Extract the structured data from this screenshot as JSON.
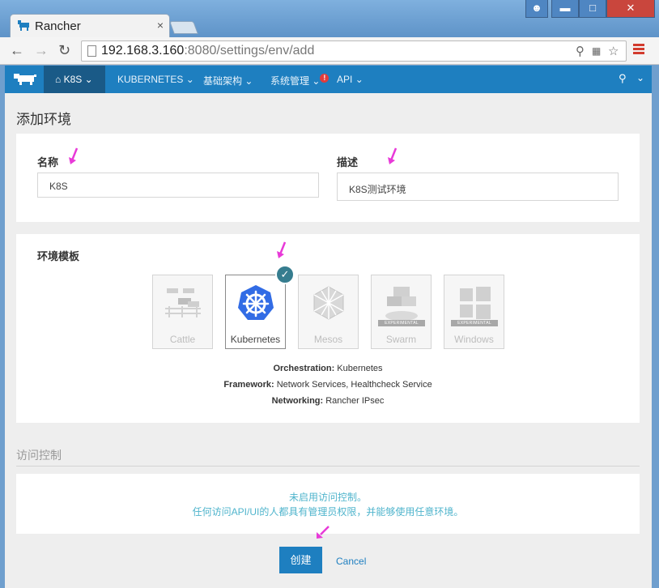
{
  "browser": {
    "tab_title": "Rancher",
    "tab_close": "×",
    "url_host": "192.168.3.160",
    "url_rest": ":8080/settings/env/add"
  },
  "nav": {
    "env": "K8S",
    "items": [
      "KUBERNETES",
      "基础架构",
      "系统管理",
      "API"
    ],
    "alert_badge": "!"
  },
  "page": {
    "title": "添加环境",
    "name_label": "名称",
    "name_value": "K8S",
    "desc_label": "描述",
    "desc_value": "K8S测试环境",
    "template_label": "环境模板",
    "templates": [
      {
        "label": "Cattle",
        "selected": false
      },
      {
        "label": "Kubernetes",
        "selected": true
      },
      {
        "label": "Mesos",
        "selected": false
      },
      {
        "label": "Swarm",
        "selected": false,
        "tag": "EXPERIMENTAL"
      },
      {
        "label": "Windows",
        "selected": false,
        "tag": "EXPERIMENTAL"
      }
    ],
    "info": [
      {
        "key": "Orchestration:",
        "value": " Kubernetes"
      },
      {
        "key": "Framework:",
        "value": " Network Services, Healthcheck Service"
      },
      {
        "key": "Networking:",
        "value": " Rancher IPsec"
      }
    ],
    "access_title": "访问控制",
    "access_line1": "未启用访问控制。",
    "access_line2": "任何访问API/UI的人都具有管理员权限，并能够使用任意环境。",
    "create_label": "创建",
    "cancel_label": "Cancel"
  },
  "colors": {
    "brand": "#1e7fc0",
    "kubernetes": "#326ce5",
    "checkmark": "#367d8f",
    "notice": "#4fb4cc",
    "annotation_arrow": "#e83ad8"
  }
}
